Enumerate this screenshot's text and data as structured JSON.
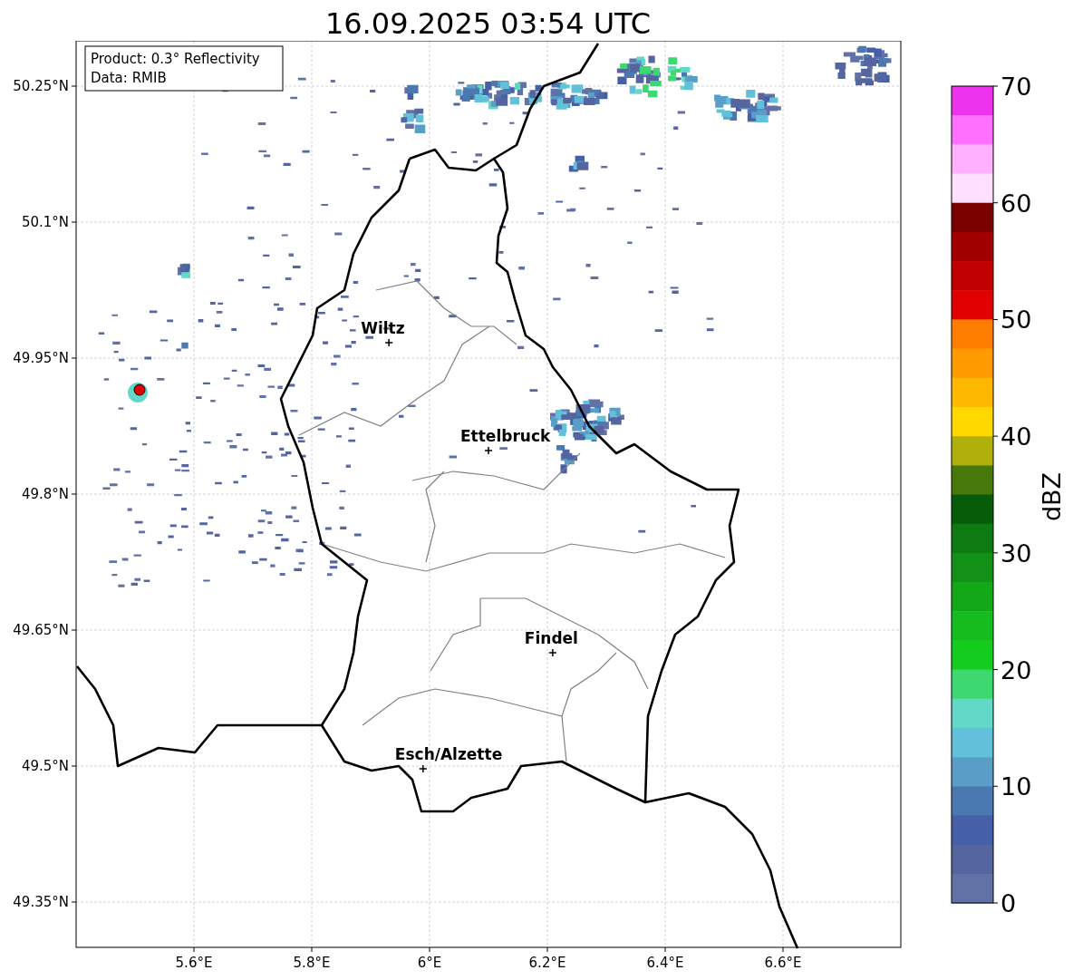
{
  "title": "16.09.2025 03:54 UTC",
  "info_box": {
    "lines": [
      "Product: 0.3° Reflectivity",
      "Data: RMIB"
    ]
  },
  "map": {
    "chart_data": {
      "type": "scatter",
      "xlim": [
        5.4,
        6.8
      ],
      "ylim": [
        49.3,
        50.3
      ],
      "grid": true,
      "xticks": [
        {
          "value": 5.6,
          "label": "5.6°E"
        },
        {
          "value": 5.8,
          "label": "5.8°E"
        },
        {
          "value": 6.0,
          "label": "6°E"
        },
        {
          "value": 6.2,
          "label": "6.2°E"
        },
        {
          "value": 6.4,
          "label": "6.4°E"
        },
        {
          "value": 6.6,
          "label": "6.6°E"
        }
      ],
      "yticks": [
        {
          "value": 49.35,
          "label": "49.35°N"
        },
        {
          "value": 49.5,
          "label": "49.5°N"
        },
        {
          "value": 49.65,
          "label": "49.65°N"
        },
        {
          "value": 49.8,
          "label": "49.8°N"
        },
        {
          "value": 49.95,
          "label": "49.95°N"
        },
        {
          "value": 50.1,
          "label": "50.1°N"
        },
        {
          "value": 50.25,
          "label": "50.25°N"
        }
      ],
      "x": [
        5.931,
        6.1,
        6.209,
        5.989
      ],
      "series": [
        {
          "color": "#000000",
          "values": [
            49.967,
            49.848,
            49.625,
            49.497
          ]
        }
      ],
      "annotations": [
        "Wiltz",
        "Ettelbruck",
        "Findel",
        "Esch/Alzette"
      ]
    }
  },
  "colorbar": {
    "label": "dBZ",
    "ticks": [
      "70",
      "60",
      "50",
      "40",
      "30",
      "20",
      "10",
      "0"
    ],
    "segments": [
      {
        "color": "#ee33ee"
      },
      {
        "color": "#ff70ff"
      },
      {
        "color": "#ffb0ff"
      },
      {
        "color": "#ffe0ff"
      },
      {
        "color": "#7a0000"
      },
      {
        "color": "#a00000"
      },
      {
        "color": "#c00000"
      },
      {
        "color": "#e00000"
      },
      {
        "color": "#ff7e00"
      },
      {
        "color": "#ff9a00"
      },
      {
        "color": "#ffb800"
      },
      {
        "color": "#ffd800"
      },
      {
        "color": "#b0b00a"
      },
      {
        "color": "#46780a"
      },
      {
        "color": "#075c0a"
      },
      {
        "color": "#0e7a12"
      },
      {
        "color": "#129018"
      },
      {
        "color": "#12a818"
      },
      {
        "color": "#14bc1e"
      },
      {
        "color": "#14cc1e"
      },
      {
        "color": "#3ed870"
      },
      {
        "color": "#63d8c8"
      },
      {
        "color": "#63c0da"
      },
      {
        "color": "#5a9ec8"
      },
      {
        "color": "#4a78b0"
      },
      {
        "color": "#4560a8"
      },
      {
        "color": "#5565a0"
      },
      {
        "color": "#6272a6"
      }
    ]
  }
}
